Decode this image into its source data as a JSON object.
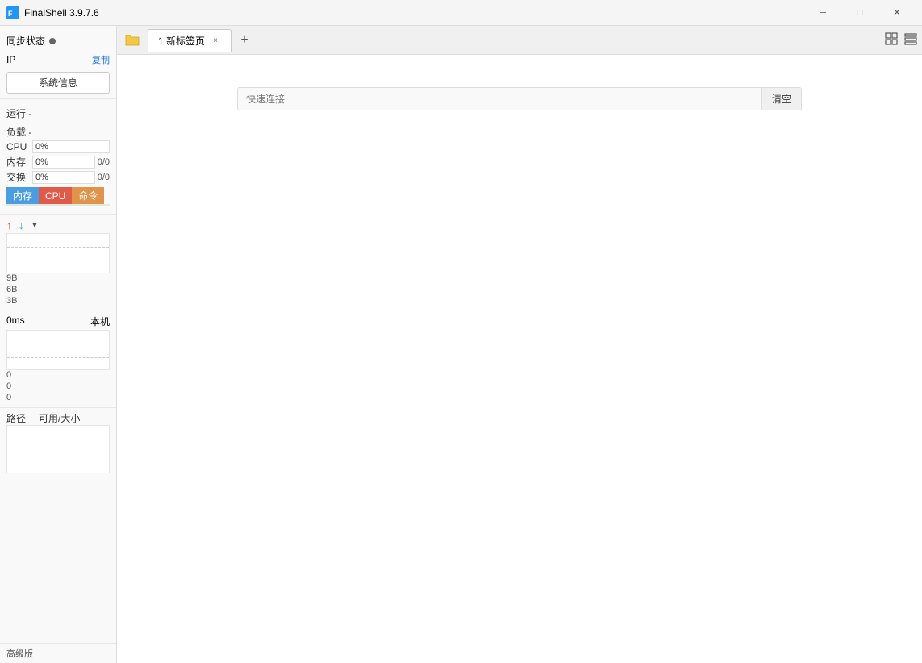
{
  "app": {
    "title": "FinalShell 3.9.7.6",
    "minimize_label": "─",
    "maximize_label": "□",
    "close_label": "✕"
  },
  "sidebar": {
    "sync_status_label": "同步状态",
    "ip_label": "IP",
    "ip_value": "-",
    "copy_label": "复制",
    "sysinfo_label": "系统信息",
    "run_label": "运行 -",
    "load_label": "负载 -",
    "cpu_label": "CPU",
    "cpu_value": "0%",
    "memory_label": "内存",
    "memory_value": "0%",
    "memory_extra": "0/0",
    "swap_label": "交换",
    "swap_value": "0%",
    "swap_extra": "0/0",
    "tab_memory": "内存",
    "tab_cpu": "CPU",
    "tab_command": "命令",
    "net_y1": "9B",
    "net_y2": "6B",
    "net_y3": "3B",
    "latency_label": "0ms",
    "latency_right": "本机",
    "latency_v1": "0",
    "latency_v2": "0",
    "latency_v3": "0",
    "disk_path_label": "路径",
    "disk_size_label": "可用/大小",
    "advanced_label": "高级版"
  },
  "tabs": {
    "folder_icon": "📁",
    "tab_label": "1 新标签页",
    "tab_close": "×",
    "add_icon": "+",
    "layout_icon_grid": "▦",
    "layout_icon_list": "▤"
  },
  "main": {
    "quick_connect_placeholder": "快速连接",
    "clear_label": "清空"
  }
}
